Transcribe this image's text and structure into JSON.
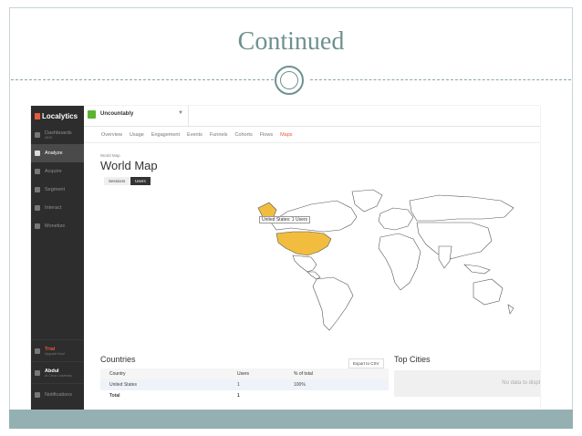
{
  "slide": {
    "title": "Continued"
  },
  "app": {
    "logo": "Localytics",
    "app_name": "Uncountably",
    "caret": "▼",
    "colors": {
      "accent": "#e8573a",
      "highlight": "#f2bd3f",
      "sidebar": "#2d2d2d"
    }
  },
  "sidebar": {
    "items": [
      {
        "label": "Dashboards",
        "sub": "NEW",
        "icon": "info-icon"
      },
      {
        "label": "Analyze",
        "icon": "chart-icon",
        "active": true
      },
      {
        "label": "Acquire",
        "icon": "download-icon"
      },
      {
        "label": "Segment",
        "icon": "segment-icon"
      },
      {
        "label": "Interact",
        "icon": "interact-icon"
      },
      {
        "label": "Monetize",
        "icon": "globe-icon"
      }
    ],
    "trial": {
      "label": "Trial",
      "sub": "Upgrade Now!"
    },
    "user": {
      "label": "Abdul",
      "sub": "At Citrus University"
    },
    "notifications": "Notifications"
  },
  "subnav": [
    "Overview",
    "Usage",
    "Engagement",
    "Events",
    "Funnels",
    "Cohorts",
    "Flows",
    "Maps"
  ],
  "main": {
    "breadcrumb": "World Map",
    "title": "World Map",
    "toggle": {
      "sessions": "Sessions",
      "users": "Users"
    },
    "tooltip": "United States: 1 Users"
  },
  "countries": {
    "title": "Countries",
    "export": "Export to CSV",
    "columns": [
      "Country",
      "Users",
      "% of total"
    ],
    "rows": [
      {
        "country": "United States",
        "users": "1",
        "pct": "100%"
      }
    ],
    "total": {
      "label": "Total",
      "users": "1"
    }
  },
  "top_cities": {
    "title": "Top Cities",
    "empty": "No data to displ"
  }
}
